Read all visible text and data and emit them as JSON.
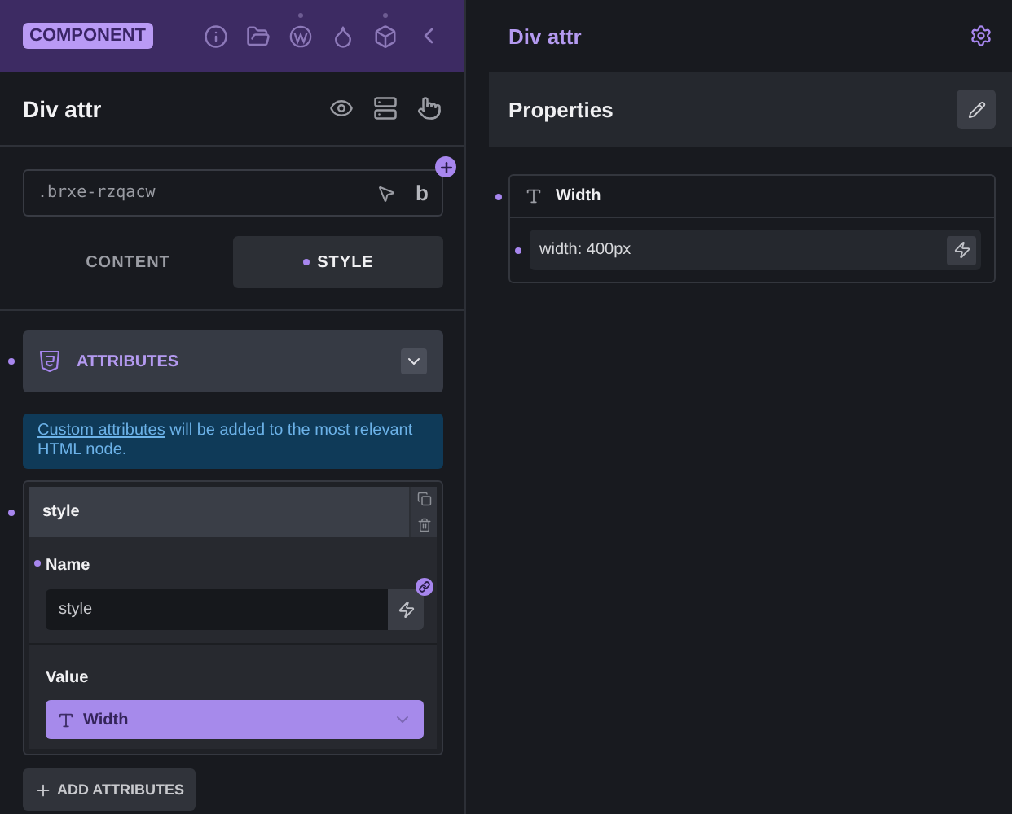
{
  "sidebar": {
    "badge": "COMPONENT",
    "element_title": "Div attr",
    "class_field": {
      "value": ".brxe-rzqacw",
      "bold_label": "b"
    },
    "tabs": [
      {
        "label": "CONTENT",
        "selected": false
      },
      {
        "label": "STYLE",
        "selected": true
      }
    ],
    "accordion": {
      "title": "ATTRIBUTES",
      "expanded": true
    },
    "notice": {
      "link": "Custom attributes",
      "text": " will be added to the most relevant HTML node."
    },
    "attributes": [
      {
        "title": "style",
        "name_label": "Name",
        "name_value": "style",
        "value_label": "Value",
        "value_selection": "Width"
      }
    ],
    "add_button": "ADD ATTRIBUTES"
  },
  "main": {
    "title": "Div attr",
    "section_title": "Properties",
    "properties": [
      {
        "label": "Width",
        "value": "width: 400px"
      }
    ]
  }
}
